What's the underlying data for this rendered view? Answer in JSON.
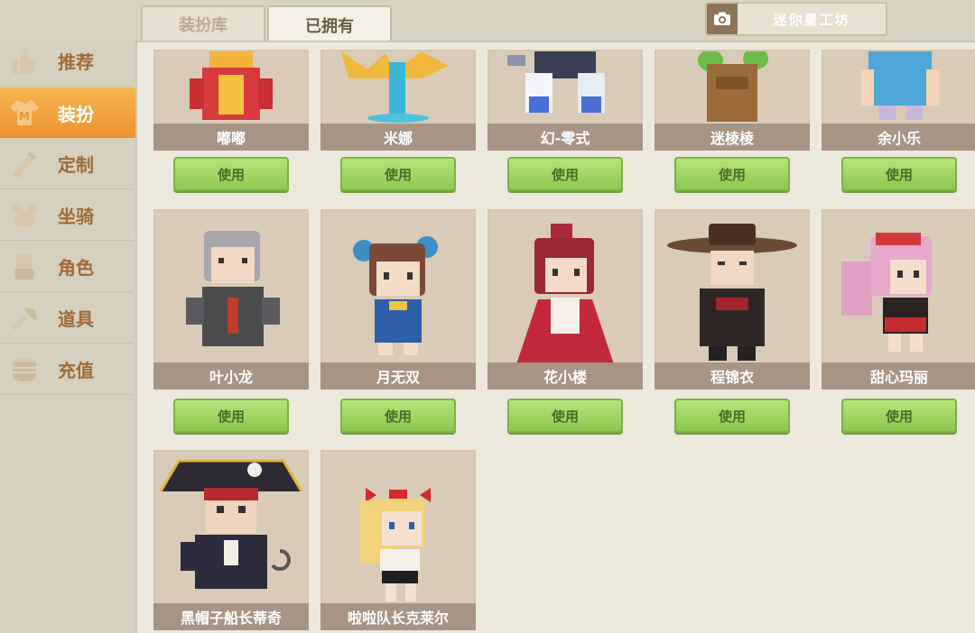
{
  "tabs": {
    "wardrobe": "装扮库",
    "owned": "已拥有"
  },
  "studio": {
    "label": "迷你星工坊",
    "icon": "camera-icon"
  },
  "sidebar": {
    "items": [
      {
        "label": "推荐",
        "icon": "thumbs-up-icon"
      },
      {
        "label": "装扮",
        "icon": "costume-icon",
        "active": true
      },
      {
        "label": "定制",
        "icon": "customize-icon"
      },
      {
        "label": "坐骑",
        "icon": "mount-icon"
      },
      {
        "label": "角色",
        "icon": "character-icon"
      },
      {
        "label": "道具",
        "icon": "item-icon"
      },
      {
        "label": "充值",
        "icon": "coins-icon"
      }
    ]
  },
  "costumes": {
    "use_label": "使用",
    "row1": [
      "嘟嘟",
      "米娜",
      "幻-零式",
      "迷棱棱",
      "余小乐"
    ],
    "row2": [
      "叶小龙",
      "月无双",
      "花小楼",
      "程锦衣",
      "甜心玛丽"
    ],
    "row3": [
      "黑帽子船长蒂奇",
      "啦啦队长克莱尔"
    ]
  },
  "colors": {
    "accent": "#f0a03c",
    "button_green": "#9fd362",
    "name_bar": "#a89484"
  }
}
